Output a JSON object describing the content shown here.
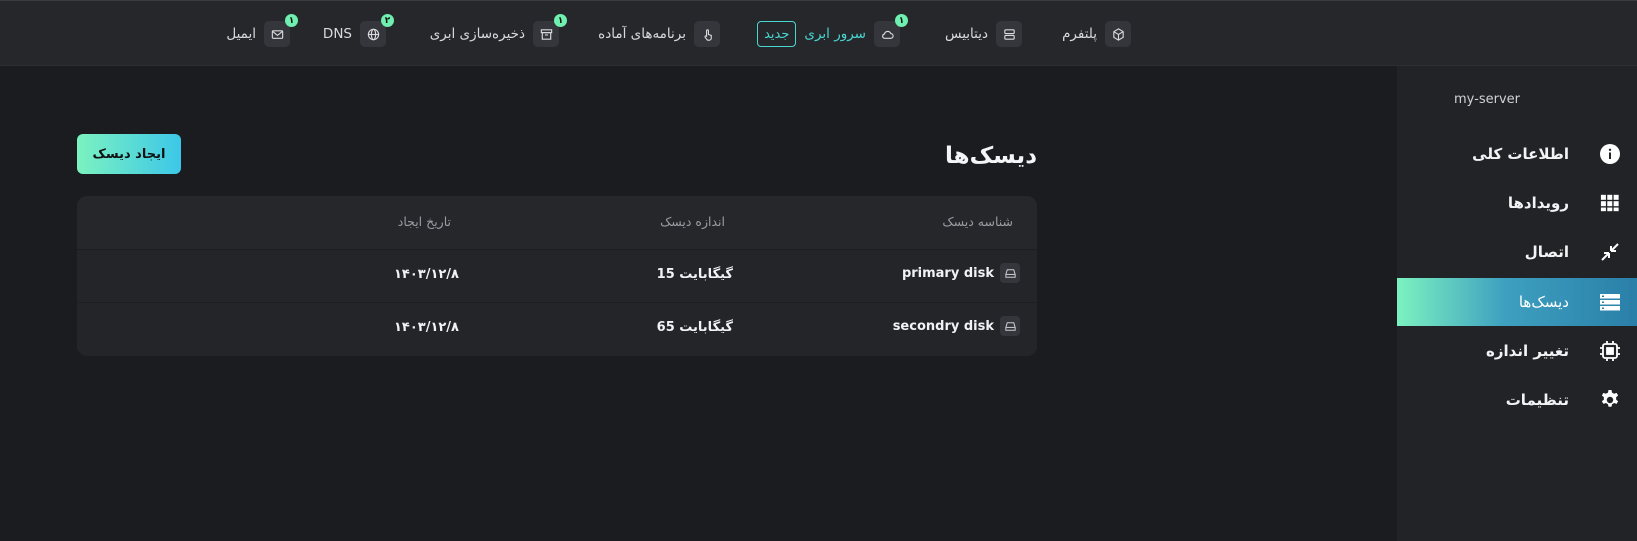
{
  "topnav": {
    "items": [
      {
        "label": "پلتفرم",
        "icon": "cube-icon"
      },
      {
        "label": "دیتابیس",
        "icon": "database-icon"
      },
      {
        "label": "سرور ابری",
        "icon": "cloud-icon",
        "badge": "۱",
        "tag": "جدید"
      },
      {
        "label": "برنامه‌های آماده",
        "icon": "touch-icon"
      },
      {
        "label": "ذخیره‌سازی ابری",
        "icon": "archive-icon",
        "badge": "۱"
      },
      {
        "label": "DNS",
        "icon": "globe-icon",
        "badge": "۲"
      },
      {
        "label": "ایمیل",
        "icon": "mail-icon",
        "badge": "۱"
      }
    ]
  },
  "sidebar": {
    "server_name": "my-server",
    "items": [
      {
        "label": "اطلاعات کلی",
        "icon": "info-icon"
      },
      {
        "label": "رویدادها",
        "icon": "grid-icon"
      },
      {
        "label": "اتصال",
        "icon": "connect-icon"
      },
      {
        "label": "دیسک‌ها",
        "icon": "disks-icon",
        "active": true
      },
      {
        "label": "تغییر اندازه",
        "icon": "chip-icon"
      },
      {
        "label": "تنظیمات",
        "icon": "gear-icon"
      }
    ]
  },
  "main": {
    "title": "دیسک‌ها",
    "create_button": "ایجاد دیسک",
    "table": {
      "headers": [
        "شناسه دیسک",
        "اندازه دیسک",
        "تاریخ ایجاد"
      ],
      "rows": [
        {
          "id": "primary disk",
          "size": "15 گیگابایت",
          "created": "۱۴۰۳/۱۲/۸"
        },
        {
          "id": "secondry disk",
          "size": "65 گیگابایت",
          "created": "۱۴۰۳/۱۲/۸"
        }
      ]
    }
  },
  "colors": {
    "accent": "#48d6d0",
    "badge": "#6ff0b0",
    "gradient_start": "#7cf2c0",
    "gradient_end": "#3cc7e8"
  }
}
